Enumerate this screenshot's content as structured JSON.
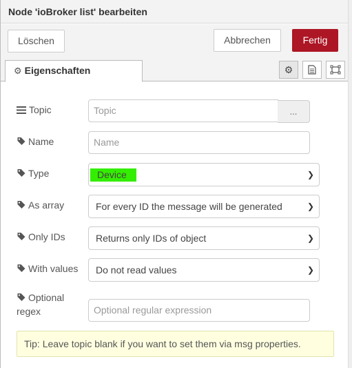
{
  "dialog": {
    "title": "Node 'ioBroker list' bearbeiten"
  },
  "buttons": {
    "delete": "Löschen",
    "cancel": "Abbrechen",
    "done": "Fertig"
  },
  "tabs": {
    "properties": "Eigenschaften"
  },
  "fields": {
    "topic": {
      "label": "Topic",
      "value": "",
      "placeholder": "Topic",
      "browse": "..."
    },
    "name": {
      "label": "Name",
      "value": "",
      "placeholder": "Name"
    },
    "type": {
      "label": "Type",
      "value": "Device"
    },
    "as_array": {
      "label": "As array",
      "value": "For every ID the message will be generated"
    },
    "only_ids": {
      "label": "Only IDs",
      "value": "Returns only IDs of object"
    },
    "with_values": {
      "label": "With values",
      "value": "Do not read values"
    },
    "regex": {
      "label_line1": "Optional",
      "label_line2": "regex",
      "value": "",
      "placeholder": "Optional regular expression"
    }
  },
  "tip": "Tip: Leave topic blank if you want to set them via msg properties.",
  "colors": {
    "done_button": "#ad1625",
    "type_highlight": "#33ee00",
    "tip_background": "#ffffe0"
  }
}
